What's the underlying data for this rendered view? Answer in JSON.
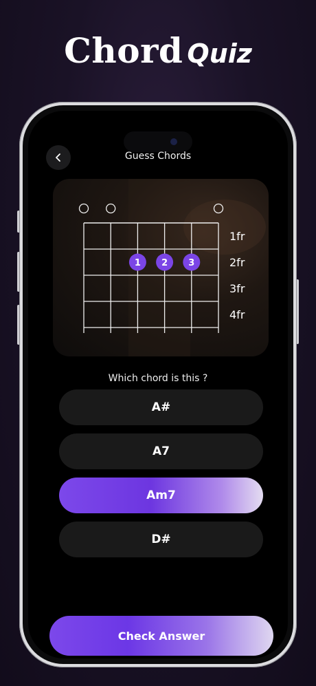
{
  "headline": {
    "title": "Chord",
    "subtitle": "Quiz"
  },
  "nav": {
    "title": "Guess Chords",
    "back_icon": "chevron-left-icon"
  },
  "chord_diagram": {
    "open_strings": [
      1,
      2,
      6
    ],
    "fret_labels": [
      "1fr",
      "2fr",
      "3fr",
      "4fr"
    ],
    "fingers": [
      {
        "label": "1",
        "string": 3,
        "fret": 2
      },
      {
        "label": "2",
        "string": 4,
        "fret": 2
      },
      {
        "label": "3",
        "string": 5,
        "fret": 2
      }
    ]
  },
  "question": "Which chord is this ?",
  "options": [
    {
      "label": "A#",
      "selected": false
    },
    {
      "label": "A7",
      "selected": false
    },
    {
      "label": "Am7",
      "selected": true
    },
    {
      "label": "D#",
      "selected": false
    }
  ],
  "check_answer_label": "Check Answer",
  "colors": {
    "accent": "#7c48ea",
    "option_bg": "#1a1a1a",
    "background": "#1a1226"
  }
}
